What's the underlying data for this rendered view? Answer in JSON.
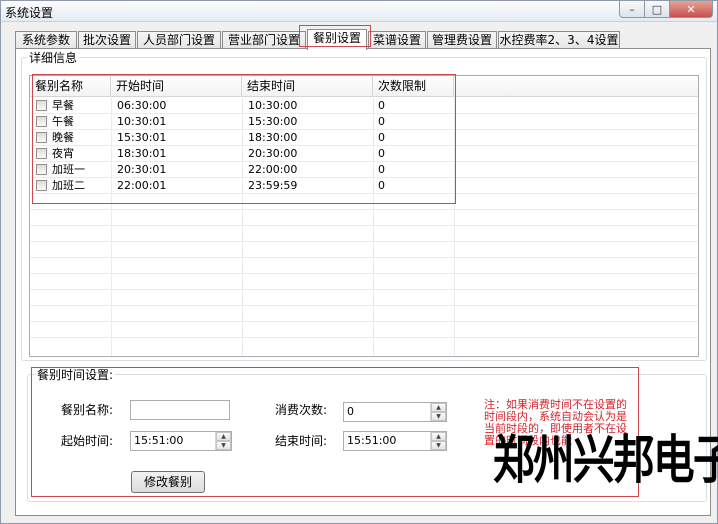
{
  "window": {
    "title": "系统设置",
    "minimize": "–",
    "maximize": "□",
    "close": "✕"
  },
  "tabs": [
    {
      "label": "系统参数",
      "active": false
    },
    {
      "label": "批次设置",
      "active": false
    },
    {
      "label": "人员部门设置",
      "active": false
    },
    {
      "label": "营业部门设置",
      "active": false
    },
    {
      "label": "餐别设置",
      "active": true
    },
    {
      "label": "菜谱设置",
      "active": false
    },
    {
      "label": "管理费设置",
      "active": false
    },
    {
      "label": "水控费率2、3、4设置",
      "active": false
    }
  ],
  "detail": {
    "legend": "详细信息",
    "columns": [
      "餐别名称",
      "开始时间",
      "结束时间",
      "次数限制"
    ],
    "rows": [
      {
        "name": "早餐",
        "start": "06:30:00",
        "end": "10:30:00",
        "limit": "0"
      },
      {
        "name": "午餐",
        "start": "10:30:01",
        "end": "15:30:00",
        "limit": "0"
      },
      {
        "name": "晚餐",
        "start": "15:30:01",
        "end": "18:30:00",
        "limit": "0"
      },
      {
        "name": "夜宵",
        "start": "18:30:01",
        "end": "20:30:00",
        "limit": "0"
      },
      {
        "name": "加班一",
        "start": "20:30:01",
        "end": "22:00:00",
        "limit": "0"
      },
      {
        "name": "加班二",
        "start": "22:00:01",
        "end": "23:59:59",
        "limit": "0"
      }
    ]
  },
  "form": {
    "legend": "餐别时间设置:",
    "name_label": "餐别名称:",
    "name_value": "",
    "count_label": "消费次数:",
    "count_value": "0",
    "start_label": "起始时间:",
    "start_value": "15:51:00",
    "end_label": "结束时间:",
    "end_value": "15:51:00",
    "submit_label": "修改餐别",
    "note": "注：如果消费时间不在设置的时间段内，系统自动会认为是当前时段的，即使用者不在设置的时间段内也能",
    "watermark": "郑州兴邦电子"
  },
  "colors": {
    "highlight": "#d0464f",
    "note": "#d0242c"
  }
}
